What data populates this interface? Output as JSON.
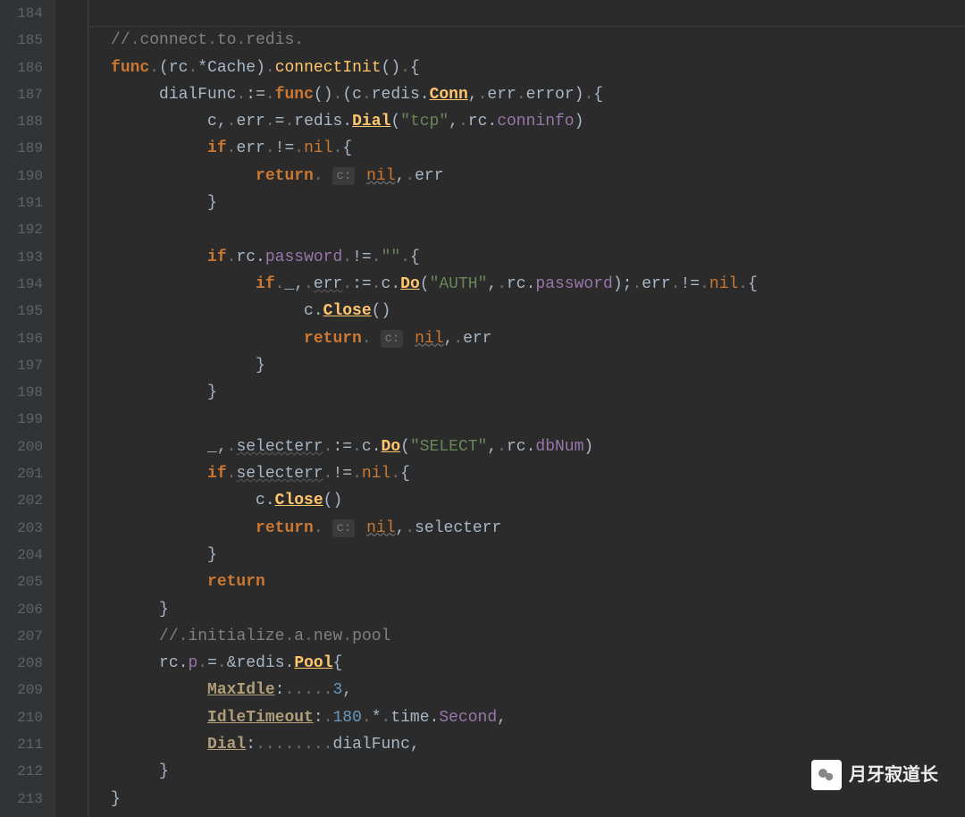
{
  "gutter": {
    "start": 184,
    "end": 213
  },
  "watermark": "月牙寂道长",
  "tokens": {
    "l185": [
      {
        "t": "//",
        "c": "cmt"
      },
      {
        "t": ".",
        "c": "dot"
      },
      {
        "t": "connect",
        "c": "cmt"
      },
      {
        "t": ".",
        "c": "dot"
      },
      {
        "t": "to",
        "c": "cmt"
      },
      {
        "t": ".",
        "c": "dot"
      },
      {
        "t": "redis.",
        "c": "cmt"
      }
    ],
    "l186": [
      {
        "t": "func",
        "c": "kw"
      },
      {
        "t": ".",
        "c": "dot"
      },
      {
        "t": "(rc",
        "c": "ident"
      },
      {
        "t": ".",
        "c": "dot"
      },
      {
        "t": "*Cache)",
        "c": "ident"
      },
      {
        "t": ".",
        "c": "dot"
      },
      {
        "t": "connectInit",
        "c": "fn"
      },
      {
        "t": "()",
        "c": "ident"
      },
      {
        "t": ".",
        "c": "dot"
      },
      {
        "t": "{",
        "c": "ident"
      }
    ],
    "l187": [
      {
        "t": "dialFunc",
        "c": "ident"
      },
      {
        "t": ".",
        "c": "dot"
      },
      {
        "t": ":=",
        "c": "op"
      },
      {
        "t": ".",
        "c": "dot"
      },
      {
        "t": "func",
        "c": "kw"
      },
      {
        "t": "()",
        "c": "ident"
      },
      {
        "t": ".",
        "c": "dot"
      },
      {
        "t": "(c",
        "c": "ident"
      },
      {
        "t": ".",
        "c": "dot"
      },
      {
        "t": "redis.",
        "c": "ident"
      },
      {
        "t": "Conn",
        "c": "fn-u"
      },
      {
        "t": ",",
        "c": "op"
      },
      {
        "t": ".",
        "c": "dot"
      },
      {
        "t": "err",
        "c": "ident"
      },
      {
        "t": ".",
        "c": "dot"
      },
      {
        "t": "error)",
        "c": "ident"
      },
      {
        "t": ".",
        "c": "dot"
      },
      {
        "t": "{",
        "c": "ident"
      }
    ],
    "l188": [
      {
        "t": "c,",
        "c": "ident"
      },
      {
        "t": ".",
        "c": "dot"
      },
      {
        "t": "err",
        "c": "ident"
      },
      {
        "t": ".",
        "c": "dot"
      },
      {
        "t": "=",
        "c": "op"
      },
      {
        "t": ".",
        "c": "dot"
      },
      {
        "t": "redis.",
        "c": "ident"
      },
      {
        "t": "Dial",
        "c": "fn-u"
      },
      {
        "t": "(",
        "c": "ident"
      },
      {
        "t": "\"tcp\"",
        "c": "str"
      },
      {
        "t": ",",
        "c": "op"
      },
      {
        "t": ".",
        "c": "dot"
      },
      {
        "t": "rc.",
        "c": "ident"
      },
      {
        "t": "conninfo",
        "c": "field"
      },
      {
        "t": ")",
        "c": "ident"
      }
    ],
    "l189": [
      {
        "t": "if",
        "c": "kw"
      },
      {
        "t": ".",
        "c": "dot"
      },
      {
        "t": "err",
        "c": "ident"
      },
      {
        "t": ".",
        "c": "dot"
      },
      {
        "t": "!=",
        "c": "op"
      },
      {
        "t": ".",
        "c": "dot"
      },
      {
        "t": "nil",
        "c": "kw-n"
      },
      {
        "t": ".",
        "c": "dot"
      },
      {
        "t": "{",
        "c": "ident"
      }
    ],
    "l190": [
      {
        "t": "return",
        "c": "kw"
      },
      {
        "t": ". ",
        "c": "dot"
      },
      {
        "t": "c:",
        "c": "hint"
      },
      {
        "t": " ",
        "c": ""
      },
      {
        "t": "nil",
        "c": "kw-n warn"
      },
      {
        "t": ",",
        "c": "op"
      },
      {
        "t": ".",
        "c": "dot"
      },
      {
        "t": "err",
        "c": "ident"
      }
    ],
    "l191": [
      {
        "t": "}",
        "c": "ident"
      }
    ],
    "l193": [
      {
        "t": "if",
        "c": "kw"
      },
      {
        "t": ".",
        "c": "dot"
      },
      {
        "t": "rc.",
        "c": "ident"
      },
      {
        "t": "password",
        "c": "field"
      },
      {
        "t": ".",
        "c": "dot"
      },
      {
        "t": "!=",
        "c": "op"
      },
      {
        "t": ".",
        "c": "dot"
      },
      {
        "t": "\"\"",
        "c": "str"
      },
      {
        "t": ".",
        "c": "dot"
      },
      {
        "t": "{",
        "c": "ident"
      }
    ],
    "l194": [
      {
        "t": "if",
        "c": "kw"
      },
      {
        "t": ".",
        "c": "dot"
      },
      {
        "t": "_,",
        "c": "ident"
      },
      {
        "t": ".",
        "c": "dot"
      },
      {
        "t": "err",
        "c": "ident warn2"
      },
      {
        "t": ".",
        "c": "dot"
      },
      {
        "t": ":=",
        "c": "op"
      },
      {
        "t": ".",
        "c": "dot"
      },
      {
        "t": "c.",
        "c": "ident"
      },
      {
        "t": "Do",
        "c": "fn-u"
      },
      {
        "t": "(",
        "c": "ident"
      },
      {
        "t": "\"AUTH\"",
        "c": "str"
      },
      {
        "t": ",",
        "c": "op"
      },
      {
        "t": ".",
        "c": "dot"
      },
      {
        "t": "rc.",
        "c": "ident"
      },
      {
        "t": "password",
        "c": "field"
      },
      {
        "t": ");",
        "c": "ident"
      },
      {
        "t": ".",
        "c": "dot"
      },
      {
        "t": "err",
        "c": "ident"
      },
      {
        "t": ".",
        "c": "dot"
      },
      {
        "t": "!=",
        "c": "op"
      },
      {
        "t": ".",
        "c": "dot"
      },
      {
        "t": "nil",
        "c": "kw-n"
      },
      {
        "t": ".",
        "c": "dot"
      },
      {
        "t": "{",
        "c": "ident"
      }
    ],
    "l195": [
      {
        "t": "c.",
        "c": "ident"
      },
      {
        "t": "Close",
        "c": "fn-u"
      },
      {
        "t": "()",
        "c": "ident"
      }
    ],
    "l196": [
      {
        "t": "return",
        "c": "kw"
      },
      {
        "t": ". ",
        "c": "dot"
      },
      {
        "t": "c:",
        "c": "hint"
      },
      {
        "t": " ",
        "c": ""
      },
      {
        "t": "nil",
        "c": "kw-n warn"
      },
      {
        "t": ",",
        "c": "op"
      },
      {
        "t": ".",
        "c": "dot"
      },
      {
        "t": "err",
        "c": "ident"
      }
    ],
    "l197": [
      {
        "t": "}",
        "c": "ident"
      }
    ],
    "l198": [
      {
        "t": "}",
        "c": "ident"
      }
    ],
    "l200": [
      {
        "t": "_,",
        "c": "ident"
      },
      {
        "t": ".",
        "c": "dot"
      },
      {
        "t": "selecterr",
        "c": "ident warn2"
      },
      {
        "t": ".",
        "c": "dot"
      },
      {
        "t": ":=",
        "c": "op"
      },
      {
        "t": ".",
        "c": "dot"
      },
      {
        "t": "c.",
        "c": "ident"
      },
      {
        "t": "Do",
        "c": "fn-u"
      },
      {
        "t": "(",
        "c": "ident"
      },
      {
        "t": "\"SELECT\"",
        "c": "str"
      },
      {
        "t": ",",
        "c": "op"
      },
      {
        "t": ".",
        "c": "dot"
      },
      {
        "t": "rc.",
        "c": "ident"
      },
      {
        "t": "dbNum",
        "c": "field"
      },
      {
        "t": ")",
        "c": "ident"
      }
    ],
    "l201": [
      {
        "t": "if",
        "c": "kw"
      },
      {
        "t": ".",
        "c": "dot"
      },
      {
        "t": "selecterr",
        "c": "ident warn2"
      },
      {
        "t": ".",
        "c": "dot"
      },
      {
        "t": "!=",
        "c": "op"
      },
      {
        "t": ".",
        "c": "dot"
      },
      {
        "t": "nil",
        "c": "kw-n"
      },
      {
        "t": ".",
        "c": "dot"
      },
      {
        "t": "{",
        "c": "ident"
      }
    ],
    "l202": [
      {
        "t": "c.",
        "c": "ident"
      },
      {
        "t": "Close",
        "c": "fn-u"
      },
      {
        "t": "()",
        "c": "ident"
      }
    ],
    "l203": [
      {
        "t": "return",
        "c": "kw"
      },
      {
        "t": ". ",
        "c": "dot"
      },
      {
        "t": "c:",
        "c": "hint"
      },
      {
        "t": " ",
        "c": ""
      },
      {
        "t": "nil",
        "c": "kw-n warn"
      },
      {
        "t": ",",
        "c": "op"
      },
      {
        "t": ".",
        "c": "dot"
      },
      {
        "t": "selecterr",
        "c": "ident"
      }
    ],
    "l204": [
      {
        "t": "}",
        "c": "ident"
      }
    ],
    "l205": [
      {
        "t": "return",
        "c": "kw"
      }
    ],
    "l206": [
      {
        "t": "}",
        "c": "ident"
      }
    ],
    "l207": [
      {
        "t": "//",
        "c": "cmt"
      },
      {
        "t": ".",
        "c": "dot"
      },
      {
        "t": "initialize",
        "c": "cmt"
      },
      {
        "t": ".",
        "c": "dot"
      },
      {
        "t": "a",
        "c": "cmt"
      },
      {
        "t": ".",
        "c": "dot"
      },
      {
        "t": "new",
        "c": "cmt"
      },
      {
        "t": ".",
        "c": "dot"
      },
      {
        "t": "pool",
        "c": "cmt"
      }
    ],
    "l208": [
      {
        "t": "rc.",
        "c": "ident"
      },
      {
        "t": "p",
        "c": "field"
      },
      {
        "t": ".",
        "c": "dot"
      },
      {
        "t": "=",
        "c": "op"
      },
      {
        "t": ".",
        "c": "dot"
      },
      {
        "t": "&redis.",
        "c": "ident"
      },
      {
        "t": "Pool",
        "c": "fn-u"
      },
      {
        "t": "{",
        "c": "ident"
      }
    ],
    "l209": [
      {
        "t": "MaxIdle",
        "c": "fn-u2"
      },
      {
        "t": ":",
        "c": "ident"
      },
      {
        "t": ".....",
        "c": "dot"
      },
      {
        "t": "3",
        "c": "num"
      },
      {
        "t": ",",
        "c": "op"
      }
    ],
    "l210": [
      {
        "t": "IdleTimeout",
        "c": "fn-u2"
      },
      {
        "t": ":",
        "c": "ident"
      },
      {
        "t": ".",
        "c": "dot"
      },
      {
        "t": "180",
        "c": "num"
      },
      {
        "t": ".",
        "c": "dot"
      },
      {
        "t": "*",
        "c": "op"
      },
      {
        "t": ".",
        "c": "dot"
      },
      {
        "t": "time.",
        "c": "ident"
      },
      {
        "t": "Second",
        "c": "field"
      },
      {
        "t": ",",
        "c": "op"
      }
    ],
    "l211": [
      {
        "t": "Dial",
        "c": "fn-u2"
      },
      {
        "t": ":",
        "c": "ident"
      },
      {
        "t": "........",
        "c": "dot"
      },
      {
        "t": "dialFunc,",
        "c": "ident"
      }
    ],
    "l212": [
      {
        "t": "}",
        "c": "ident"
      }
    ],
    "l213": [
      {
        "t": "}",
        "c": "ident"
      }
    ]
  },
  "indents": {
    "l185": 1,
    "l186": 1,
    "l187": 2,
    "l188": 3,
    "l189": 3,
    "l190": 4,
    "l191": 3,
    "l193": 3,
    "l194": 4,
    "l195": 5,
    "l196": 5,
    "l197": 4,
    "l198": 3,
    "l200": 3,
    "l201": 3,
    "l202": 4,
    "l203": 4,
    "l204": 3,
    "l205": 3,
    "l206": 2,
    "l207": 2,
    "l208": 2,
    "l209": 3,
    "l210": 3,
    "l211": 3,
    "l212": 2,
    "l213": 1
  }
}
